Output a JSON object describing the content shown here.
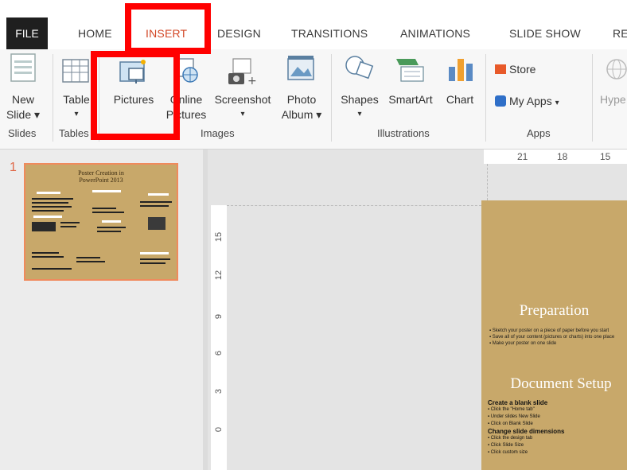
{
  "tabs": {
    "file": "FILE",
    "home": "HOME",
    "insert": "INSERT",
    "design": "DESIGN",
    "transitions": "TRANSITIONS",
    "animations": "ANIMATIONS",
    "slideshow": "SLIDE SHOW",
    "review_partial": "RE"
  },
  "ribbon": {
    "new_slide_1": "New",
    "new_slide_2": "Slide",
    "table": "Table",
    "pictures": "Pictures",
    "online_1": "Online",
    "online_2": "Pictures",
    "screenshot": "Screenshot",
    "photo_1": "Photo",
    "photo_2": "Album",
    "shapes": "Shapes",
    "smartart": "SmartArt",
    "chart": "Chart",
    "store": "Store",
    "myapps": "My Apps",
    "hyper_partial": "Hype",
    "groups": {
      "slides": "Slides",
      "tables": "Tables",
      "images": "Images",
      "illustrations": "Illustrations",
      "apps": "Apps"
    }
  },
  "thumbnail": {
    "number": "1",
    "title_1": "Poster Creation in",
    "title_2": "PowerPoint 2013"
  },
  "ruler": {
    "h": [
      "21",
      "18",
      "15"
    ],
    "v": [
      "15",
      "12",
      "9",
      "6",
      "3",
      "0"
    ]
  },
  "slide": {
    "heading1": "Preparation",
    "bullets": [
      "Sketch your poster on a piece of paper before you start",
      "Save all of your content (pictures or charts) into one place",
      "Make your poster on one slide"
    ],
    "heading2": "Document Setup",
    "sub1": "Create a blank slide",
    "sub1_items": [
      "Click the \"Home tab\"",
      "Under slides New Slide",
      "Click on Blank Slide"
    ],
    "sub2": "Change slide dimensions",
    "sub2_items": [
      "Click the design tab",
      "Click Slide Size",
      "Click custom size"
    ]
  },
  "colors": {
    "accent": "#d24726",
    "slide_bg": "#c8a86a",
    "highlight": "#ff0000"
  }
}
